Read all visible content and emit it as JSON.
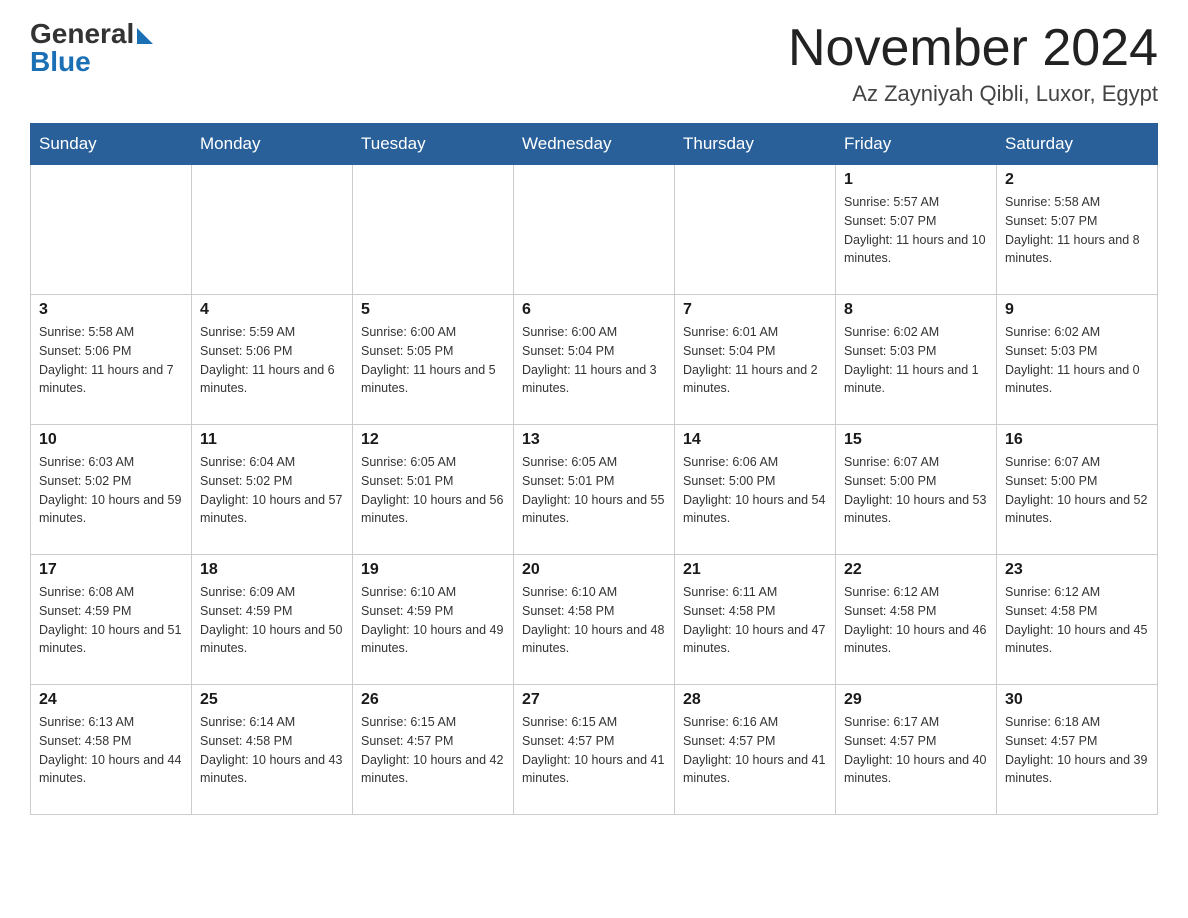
{
  "header": {
    "logo_general": "General",
    "logo_blue": "Blue",
    "month": "November 2024",
    "location": "Az Zayniyah Qibli, Luxor, Egypt"
  },
  "days_of_week": [
    "Sunday",
    "Monday",
    "Tuesday",
    "Wednesday",
    "Thursday",
    "Friday",
    "Saturday"
  ],
  "weeks": [
    [
      {
        "day": "",
        "info": ""
      },
      {
        "day": "",
        "info": ""
      },
      {
        "day": "",
        "info": ""
      },
      {
        "day": "",
        "info": ""
      },
      {
        "day": "",
        "info": ""
      },
      {
        "day": "1",
        "info": "Sunrise: 5:57 AM\nSunset: 5:07 PM\nDaylight: 11 hours and 10 minutes."
      },
      {
        "day": "2",
        "info": "Sunrise: 5:58 AM\nSunset: 5:07 PM\nDaylight: 11 hours and 8 minutes."
      }
    ],
    [
      {
        "day": "3",
        "info": "Sunrise: 5:58 AM\nSunset: 5:06 PM\nDaylight: 11 hours and 7 minutes."
      },
      {
        "day": "4",
        "info": "Sunrise: 5:59 AM\nSunset: 5:06 PM\nDaylight: 11 hours and 6 minutes."
      },
      {
        "day": "5",
        "info": "Sunrise: 6:00 AM\nSunset: 5:05 PM\nDaylight: 11 hours and 5 minutes."
      },
      {
        "day": "6",
        "info": "Sunrise: 6:00 AM\nSunset: 5:04 PM\nDaylight: 11 hours and 3 minutes."
      },
      {
        "day": "7",
        "info": "Sunrise: 6:01 AM\nSunset: 5:04 PM\nDaylight: 11 hours and 2 minutes."
      },
      {
        "day": "8",
        "info": "Sunrise: 6:02 AM\nSunset: 5:03 PM\nDaylight: 11 hours and 1 minute."
      },
      {
        "day": "9",
        "info": "Sunrise: 6:02 AM\nSunset: 5:03 PM\nDaylight: 11 hours and 0 minutes."
      }
    ],
    [
      {
        "day": "10",
        "info": "Sunrise: 6:03 AM\nSunset: 5:02 PM\nDaylight: 10 hours and 59 minutes."
      },
      {
        "day": "11",
        "info": "Sunrise: 6:04 AM\nSunset: 5:02 PM\nDaylight: 10 hours and 57 minutes."
      },
      {
        "day": "12",
        "info": "Sunrise: 6:05 AM\nSunset: 5:01 PM\nDaylight: 10 hours and 56 minutes."
      },
      {
        "day": "13",
        "info": "Sunrise: 6:05 AM\nSunset: 5:01 PM\nDaylight: 10 hours and 55 minutes."
      },
      {
        "day": "14",
        "info": "Sunrise: 6:06 AM\nSunset: 5:00 PM\nDaylight: 10 hours and 54 minutes."
      },
      {
        "day": "15",
        "info": "Sunrise: 6:07 AM\nSunset: 5:00 PM\nDaylight: 10 hours and 53 minutes."
      },
      {
        "day": "16",
        "info": "Sunrise: 6:07 AM\nSunset: 5:00 PM\nDaylight: 10 hours and 52 minutes."
      }
    ],
    [
      {
        "day": "17",
        "info": "Sunrise: 6:08 AM\nSunset: 4:59 PM\nDaylight: 10 hours and 51 minutes."
      },
      {
        "day": "18",
        "info": "Sunrise: 6:09 AM\nSunset: 4:59 PM\nDaylight: 10 hours and 50 minutes."
      },
      {
        "day": "19",
        "info": "Sunrise: 6:10 AM\nSunset: 4:59 PM\nDaylight: 10 hours and 49 minutes."
      },
      {
        "day": "20",
        "info": "Sunrise: 6:10 AM\nSunset: 4:58 PM\nDaylight: 10 hours and 48 minutes."
      },
      {
        "day": "21",
        "info": "Sunrise: 6:11 AM\nSunset: 4:58 PM\nDaylight: 10 hours and 47 minutes."
      },
      {
        "day": "22",
        "info": "Sunrise: 6:12 AM\nSunset: 4:58 PM\nDaylight: 10 hours and 46 minutes."
      },
      {
        "day": "23",
        "info": "Sunrise: 6:12 AM\nSunset: 4:58 PM\nDaylight: 10 hours and 45 minutes."
      }
    ],
    [
      {
        "day": "24",
        "info": "Sunrise: 6:13 AM\nSunset: 4:58 PM\nDaylight: 10 hours and 44 minutes."
      },
      {
        "day": "25",
        "info": "Sunrise: 6:14 AM\nSunset: 4:58 PM\nDaylight: 10 hours and 43 minutes."
      },
      {
        "day": "26",
        "info": "Sunrise: 6:15 AM\nSunset: 4:57 PM\nDaylight: 10 hours and 42 minutes."
      },
      {
        "day": "27",
        "info": "Sunrise: 6:15 AM\nSunset: 4:57 PM\nDaylight: 10 hours and 41 minutes."
      },
      {
        "day": "28",
        "info": "Sunrise: 6:16 AM\nSunset: 4:57 PM\nDaylight: 10 hours and 41 minutes."
      },
      {
        "day": "29",
        "info": "Sunrise: 6:17 AM\nSunset: 4:57 PM\nDaylight: 10 hours and 40 minutes."
      },
      {
        "day": "30",
        "info": "Sunrise: 6:18 AM\nSunset: 4:57 PM\nDaylight: 10 hours and 39 minutes."
      }
    ]
  ]
}
